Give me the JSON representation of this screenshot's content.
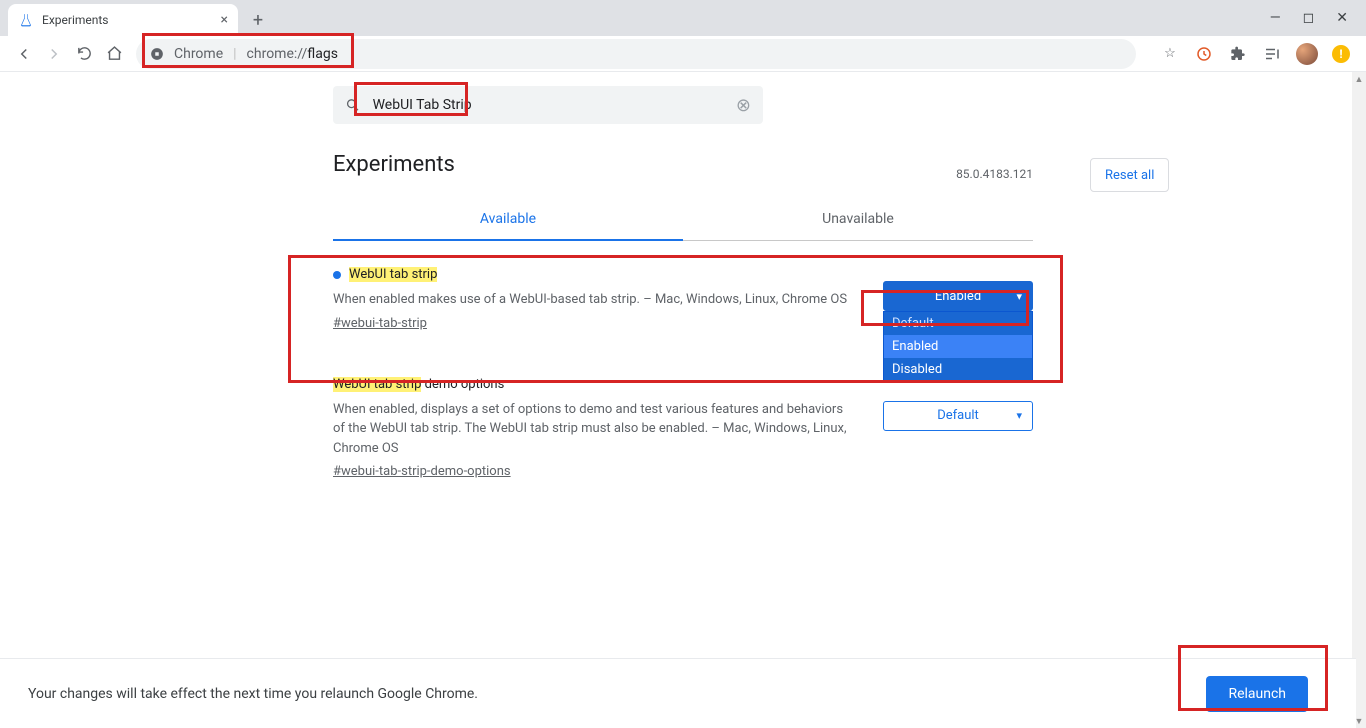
{
  "browser": {
    "tab_title": "Experiments",
    "omnibox_origin": "Chrome",
    "omnibox_prefix": "chrome://",
    "omnibox_path": "flags"
  },
  "search": {
    "value": "WebUI Tab Strip",
    "reset_label": "Reset all"
  },
  "page_title": "Experiments",
  "version": "85.0.4183.121",
  "tabs": [
    "Available",
    "Unavailable"
  ],
  "flags": [
    {
      "title": "WebUI tab strip",
      "desc": "When enabled makes use of a WebUI-based tab strip. – Mac, Windows, Linux, Chrome OS",
      "hash": "#webui-tab-strip",
      "select": "Enabled",
      "modified": true
    },
    {
      "title": "WebUI tab strip",
      "title_suffix": " demo options",
      "desc": "When enabled, displays a set of options to demo and test various features and behaviors of the WebUI tab strip. The WebUI tab strip must also be enabled. – Mac, Windows, Linux, Chrome OS",
      "hash": "#webui-tab-strip-demo-options",
      "select": "Default",
      "modified": false
    }
  ],
  "dropdown_options": [
    "Default",
    "Enabled",
    "Disabled"
  ],
  "restart_msg": "Your changes will take effect the next time you relaunch Google Chrome.",
  "relaunch_label": "Relaunch"
}
